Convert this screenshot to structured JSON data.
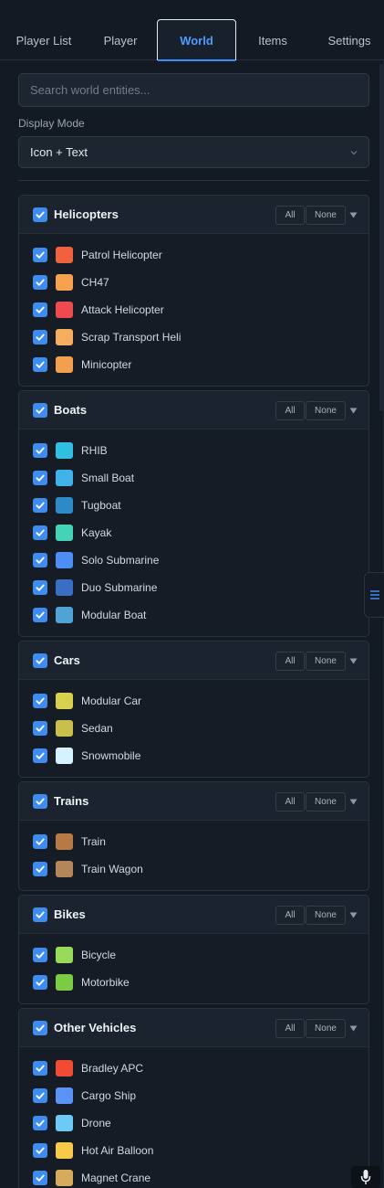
{
  "tabs": [
    {
      "label": "Player List",
      "active": false
    },
    {
      "label": "Player",
      "active": false
    },
    {
      "label": "World",
      "active": true
    },
    {
      "label": "Items",
      "active": false
    },
    {
      "label": "Settings",
      "active": false
    }
  ],
  "search": {
    "placeholder": "Search world entities..."
  },
  "display_mode": {
    "label": "Display Mode",
    "value": "Icon + Text"
  },
  "buttons": {
    "all": "All",
    "none": "None"
  },
  "colors": {
    "accent": "#3f8cf0",
    "tab_active": "#4f9bff",
    "background": "#131a23"
  },
  "groups": [
    {
      "title": "Helicopters",
      "checked": true,
      "items": [
        {
          "label": "Patrol Helicopter",
          "color": "#f0623f",
          "checked": true
        },
        {
          "label": "CH47",
          "color": "#f6a14e",
          "checked": true
        },
        {
          "label": "Attack Helicopter",
          "color": "#ef4a50",
          "checked": true
        },
        {
          "label": "Scrap Transport Heli",
          "color": "#f5ad5f",
          "checked": true
        },
        {
          "label": "Minicopter",
          "color": "#f2a04f",
          "checked": true
        }
      ]
    },
    {
      "title": "Boats",
      "checked": true,
      "items": [
        {
          "label": "RHIB",
          "color": "#2fbfe3",
          "checked": true
        },
        {
          "label": "Small Boat",
          "color": "#3fb2ea",
          "checked": true
        },
        {
          "label": "Tugboat",
          "color": "#2c8ac6",
          "checked": true
        },
        {
          "label": "Kayak",
          "color": "#45d3b7",
          "checked": true
        },
        {
          "label": "Solo Submarine",
          "color": "#4d8ef5",
          "checked": true
        },
        {
          "label": "Duo Submarine",
          "color": "#3a6ec5",
          "checked": true
        },
        {
          "label": "Modular Boat",
          "color": "#4fa3d6",
          "checked": true
        }
      ]
    },
    {
      "title": "Cars",
      "checked": true,
      "items": [
        {
          "label": "Modular Car",
          "color": "#d8cf4c",
          "checked": true
        },
        {
          "label": "Sedan",
          "color": "#c8c04a",
          "checked": true
        },
        {
          "label": "Snowmobile",
          "color": "#d6f2ff",
          "checked": true
        }
      ]
    },
    {
      "title": "Trains",
      "checked": true,
      "items": [
        {
          "label": "Train",
          "color": "#b77a47",
          "checked": true
        },
        {
          "label": "Train Wagon",
          "color": "#b4865a",
          "checked": true
        }
      ]
    },
    {
      "title": "Bikes",
      "checked": true,
      "items": [
        {
          "label": "Bicycle",
          "color": "#9ada5b",
          "checked": true
        },
        {
          "label": "Motorbike",
          "color": "#7ccb45",
          "checked": true
        }
      ]
    },
    {
      "title": "Other Vehicles",
      "checked": true,
      "items": [
        {
          "label": "Bradley APC",
          "color": "#f24b33",
          "checked": true
        },
        {
          "label": "Cargo Ship",
          "color": "#5b92f6",
          "checked": true
        },
        {
          "label": "Drone",
          "color": "#6dc9f6",
          "checked": true
        },
        {
          "label": "Hot Air Balloon",
          "color": "#f8c94b",
          "checked": true
        },
        {
          "label": "Magnet Crane",
          "color": "#d8aa5c",
          "checked": true
        }
      ]
    }
  ],
  "icons": {
    "collapse": "caret-down-icon",
    "side_tab": "menu-icon",
    "mic": "microphone-icon"
  }
}
